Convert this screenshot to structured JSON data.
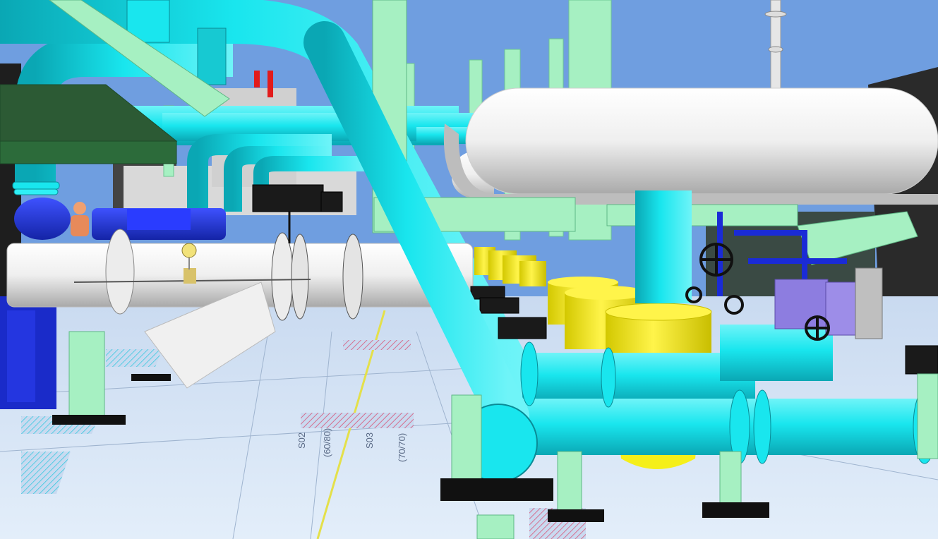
{
  "scene": {
    "description_type": "3d-piping-model-render",
    "colors": {
      "sky": "#6f9ee0",
      "floor": "#d7e6f7",
      "pipe_cyan": "#19e6ee",
      "pipe_white": "#f2f2f2",
      "steel_green": "#a6f0c2",
      "strainer_yellow": "#f5ef1a",
      "motor_blue": "#1f2fd6",
      "valve_black": "#1a1a1a",
      "hatch_pink": "#e8a0b8",
      "hatch_cyan": "#4fd6e6"
    },
    "icons": [
      "handwheel-icon",
      "pressure-gauge-icon",
      "operator-figure-icon"
    ]
  },
  "floor_labels": {
    "s02": "S02",
    "s02_sub": "(60/80)",
    "s03": "S03",
    "s03_sub": "(70/70)"
  }
}
